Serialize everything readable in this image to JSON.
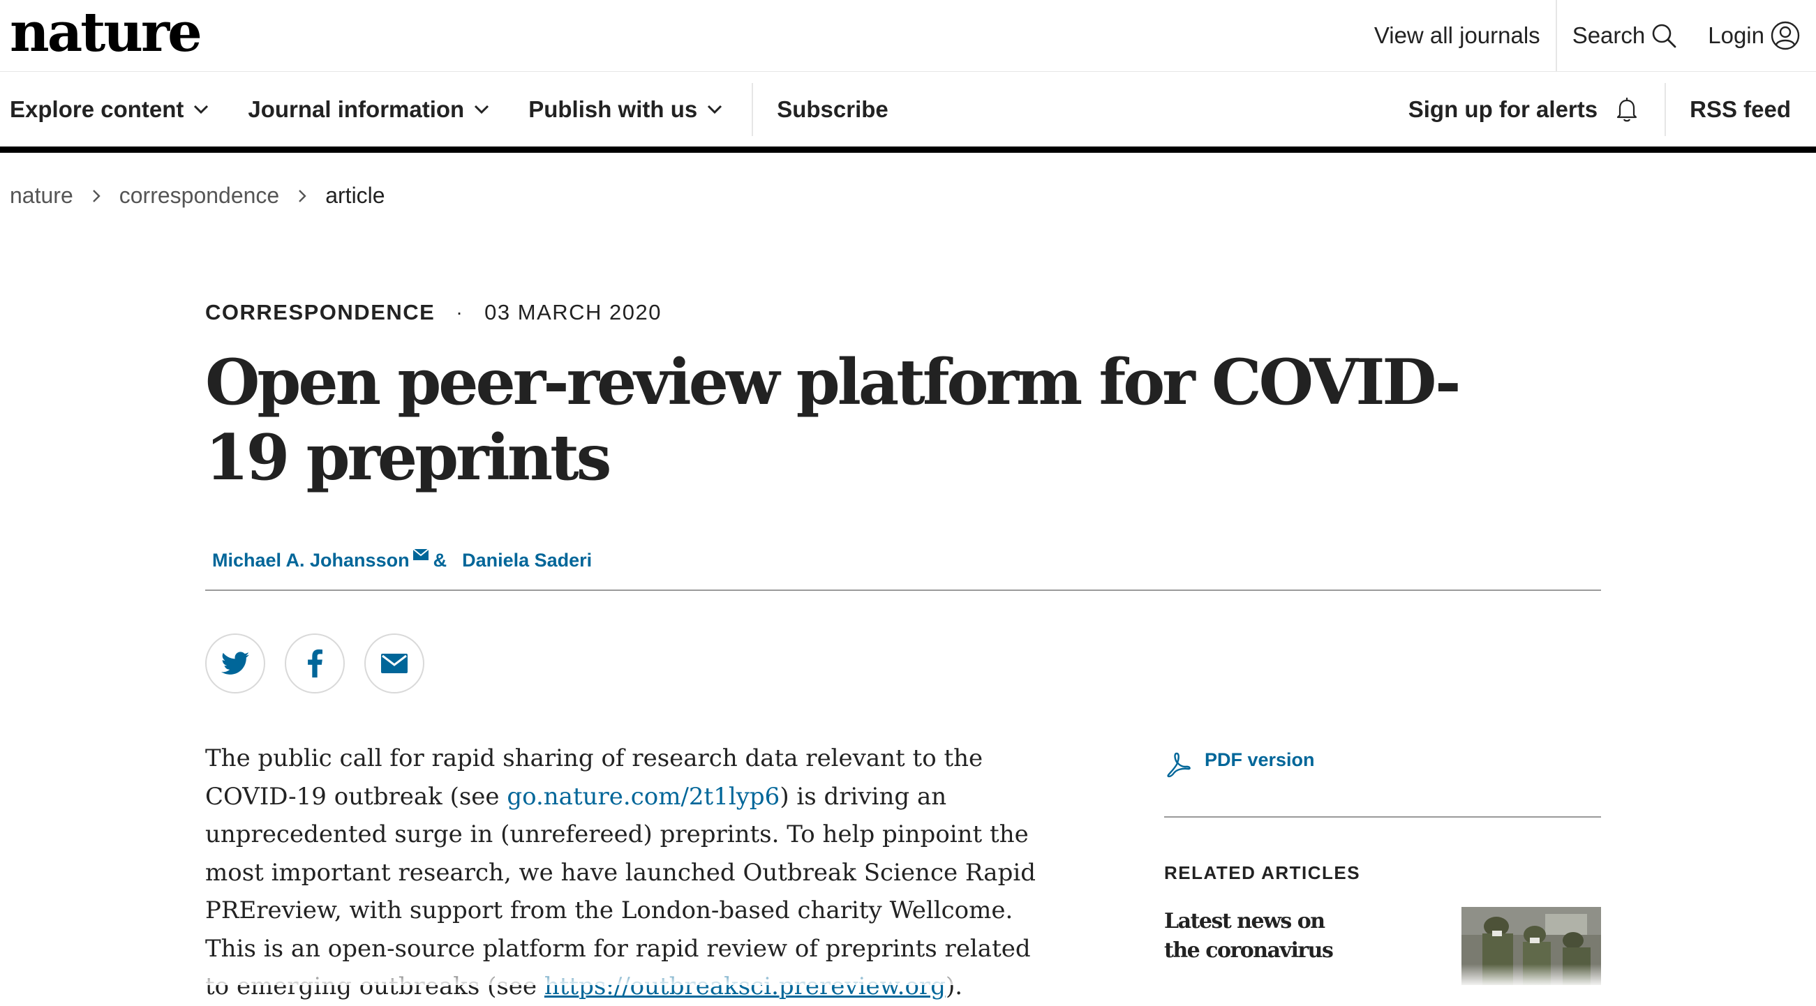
{
  "header": {
    "logo": "nature",
    "view_all_journals": "View all journals",
    "search_label": "Search",
    "login_label": "Login"
  },
  "nav": {
    "explore_content": "Explore content",
    "journal_information": "Journal information",
    "publish_with_us": "Publish with us",
    "subscribe": "Subscribe",
    "sign_up_alerts": "Sign up for alerts",
    "rss_feed": "RSS feed"
  },
  "breadcrumb": {
    "items": [
      "nature",
      "correspondence",
      "article"
    ]
  },
  "article": {
    "type": "CORRESPONDENCE",
    "dot": "·",
    "date": "03 MARCH 2020",
    "title": "Open peer-review platform for COVID-19 preprints",
    "authors": [
      "Michael A. Johansson",
      "Daniela Saderi"
    ],
    "author_separator": "&",
    "body": {
      "part1": "The public call for rapid sharing of research data relevant to the COVID-19 outbreak (see ",
      "link1": "go.nature.com/2t1lyp6",
      "part2": ") is driving an unprecedented surge in (unrefereed) preprints. To help pinpoint the most important research, we have launched Outbreak Science Rapid PREreview, with support from the London-based charity Wellcome. This is an open-source platform for rapid review of preprints related to emerging outbreaks (see ",
      "link2": "https://outbreaksci.prereview.org",
      "part3": ")."
    }
  },
  "share": {
    "icons": [
      "twitter-icon",
      "facebook-icon",
      "email-icon"
    ]
  },
  "sidebar": {
    "pdf_label": "PDF version",
    "related_heading": "RELATED ARTICLES",
    "related_items": [
      {
        "title": "Latest news on the coronavirus"
      }
    ]
  },
  "colors": {
    "link": "#006699",
    "text": "#222222",
    "nav_rule": "#000000"
  }
}
